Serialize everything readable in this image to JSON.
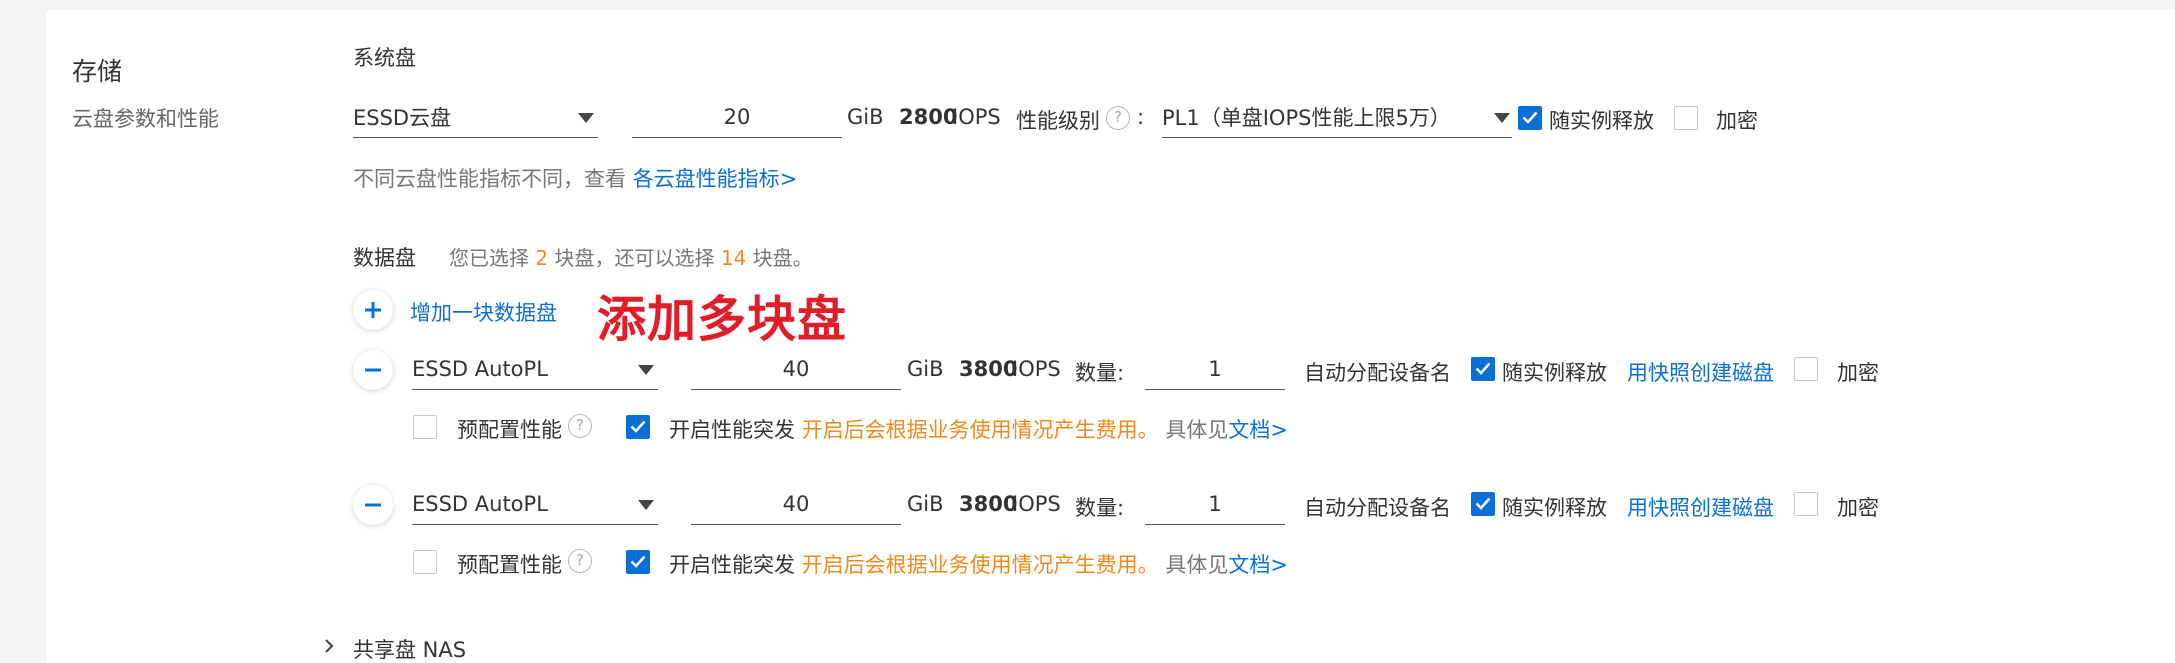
{
  "storage": {
    "title": "存储",
    "subtitle": "云盘参数和性能"
  },
  "system_disk": {
    "label": "系统盘",
    "type": "ESSD云盘",
    "size": "20",
    "unit": "GiB",
    "iops_value": "2800",
    "iops_label": "IOPS",
    "perf_level_label": "性能级别",
    "colon": ":",
    "perf_level_value": "PL1（单盘IOPS性能上限5万）",
    "release_with_instance": {
      "label": "随实例释放",
      "checked": true
    },
    "encrypt": {
      "label": "加密",
      "checked": false
    },
    "hint_text": "不同云盘性能指标不同，查看",
    "hint_link": "各云盘性能指标>"
  },
  "data_disk": {
    "label": "数据盘",
    "summary_prefix": "您已选择",
    "selected_count": "2",
    "summary_mid": "块盘，还可以选择",
    "remaining_count": "14",
    "summary_suffix": "块盘。",
    "add_label": "增加一块数据盘",
    "annotation": "添加多块盘",
    "disks": [
      {
        "type": "ESSD AutoPL",
        "size": "40",
        "unit": "GiB",
        "iops_value": "3800",
        "iops_label": "IOPS",
        "quantity_label": "数量:",
        "quantity": "1",
        "device_name": "自动分配设备名",
        "release_with_instance": {
          "label": "随实例释放",
          "checked": true
        },
        "snapshot_link": "用快照创建磁盘",
        "encrypt": {
          "label": "加密",
          "checked": false
        },
        "provisioned": {
          "label": "预配置性能",
          "checked": false
        },
        "burst": {
          "label": "开启性能突发",
          "checked": true
        },
        "burst_note": "开启后会根据业务使用情况产生费用。",
        "detail_prefix": "具体见",
        "detail_link": "文档>"
      },
      {
        "type": "ESSD AutoPL",
        "size": "40",
        "unit": "GiB",
        "iops_value": "3800",
        "iops_label": "IOPS",
        "quantity_label": "数量:",
        "quantity": "1",
        "device_name": "自动分配设备名",
        "release_with_instance": {
          "label": "随实例释放",
          "checked": true
        },
        "snapshot_link": "用快照创建磁盘",
        "encrypt": {
          "label": "加密",
          "checked": false
        },
        "provisioned": {
          "label": "预配置性能",
          "checked": false
        },
        "burst": {
          "label": "开启性能突发",
          "checked": true
        },
        "burst_note": "开启后会根据业务使用情况产生费用。",
        "detail_prefix": "具体见",
        "detail_link": "文档>"
      }
    ]
  },
  "shared_nas": {
    "label": "共享盘 NAS"
  },
  "colors": {
    "accent": "#0a6fd6",
    "warning": "#f08a1c",
    "annotation": "#e11d2a"
  }
}
